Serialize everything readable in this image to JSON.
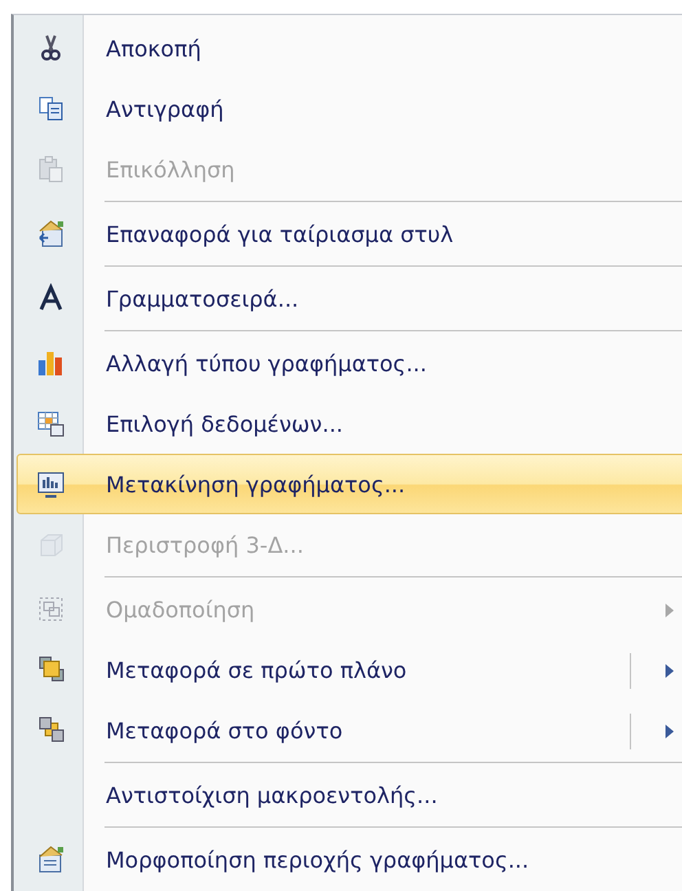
{
  "menu": {
    "items": [
      {
        "kind": "item",
        "label": "Αποκοπή",
        "disabled": false,
        "selected": false
      },
      {
        "kind": "item",
        "label": "Αντιγραφή",
        "disabled": false,
        "selected": false
      },
      {
        "kind": "item",
        "label": "Επικόλληση",
        "disabled": true,
        "selected": false
      },
      {
        "kind": "separator"
      },
      {
        "kind": "item",
        "label": "Επαναφορά για ταίριασμα στυλ",
        "disabled": false,
        "selected": false
      },
      {
        "kind": "separator"
      },
      {
        "kind": "item",
        "label": "Γραμματοσειρά...",
        "disabled": false,
        "selected": false
      },
      {
        "kind": "separator"
      },
      {
        "kind": "item",
        "label": "Αλλαγή τύπου γραφήματος...",
        "disabled": false,
        "selected": false
      },
      {
        "kind": "item",
        "label": "Επιλογή δεδομένων...",
        "disabled": false,
        "selected": false
      },
      {
        "kind": "item",
        "label": "Μετακίνηση γραφήματος...",
        "disabled": false,
        "selected": true
      },
      {
        "kind": "item",
        "label": "Περιστροφή 3-Δ...",
        "disabled": true,
        "selected": false
      },
      {
        "kind": "separator"
      },
      {
        "kind": "submenu",
        "label": "Ομαδοποίηση",
        "disabled": true,
        "selected": false,
        "split": false
      },
      {
        "kind": "submenu",
        "label": "Μεταφορά σε πρώτο πλάνο",
        "disabled": false,
        "selected": false,
        "split": true
      },
      {
        "kind": "submenu",
        "label": "Μεταφορά στο φόντο",
        "disabled": false,
        "selected": false,
        "split": true
      },
      {
        "kind": "separator"
      },
      {
        "kind": "item",
        "label": "Αντιστοίχιση μακροεντολής...",
        "disabled": false,
        "selected": false
      },
      {
        "kind": "separator"
      },
      {
        "kind": "item",
        "label": "Μορφοποίηση περιοχής γραφήματος...",
        "disabled": false,
        "selected": false
      }
    ]
  }
}
